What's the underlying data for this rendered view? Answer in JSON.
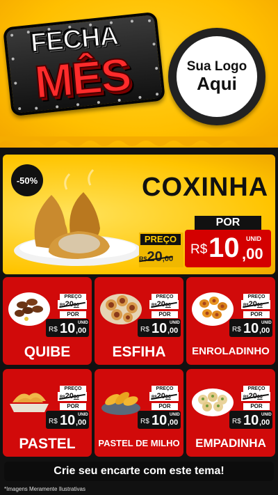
{
  "header": {
    "badge_line1": "FECHA",
    "badge_line2": "MÊS",
    "logo_line1": "Sua Logo",
    "logo_line2": "Aqui"
  },
  "featured": {
    "discount": "-50%",
    "name": "COXINHA",
    "preco_label": "PREÇO",
    "old_currency": "R$",
    "old_int": "20",
    "old_dec": ",00",
    "por_label": "POR",
    "new_currency": "R$",
    "new_int": "10",
    "new_dec": ",00",
    "unid": "UNID"
  },
  "products": [
    {
      "name": "QUIBE",
      "preco_label": "PREÇO",
      "old_currency": "R$",
      "old_int": "20",
      "old_dec": "00",
      "por_label": "POR",
      "new_currency": "R$",
      "new_int": "10",
      "new_dec": ",00",
      "unid": "UNID"
    },
    {
      "name": "ESFIHA",
      "preco_label": "PREÇO",
      "old_currency": "R$",
      "old_int": "20",
      "old_dec": "00",
      "por_label": "POR",
      "new_currency": "R$",
      "new_int": "10",
      "new_dec": ",00",
      "unid": "UNID"
    },
    {
      "name": "ENROLADINHO",
      "preco_label": "PREÇO",
      "old_currency": "R$",
      "old_int": "20",
      "old_dec": "00",
      "por_label": "POR",
      "new_currency": "R$",
      "new_int": "10",
      "new_dec": ",00",
      "unid": "UNID"
    },
    {
      "name": "PASTEL",
      "preco_label": "PREÇO",
      "old_currency": "R$",
      "old_int": "20",
      "old_dec": "00",
      "por_label": "POR",
      "new_currency": "R$",
      "new_int": "10",
      "new_dec": ",00",
      "unid": "UNID"
    },
    {
      "name": "PASTEL DE MILHO",
      "preco_label": "PREÇO",
      "old_currency": "R$",
      "old_int": "20",
      "old_dec": "00",
      "por_label": "POR",
      "new_currency": "R$",
      "new_int": "10",
      "new_dec": ",00",
      "unid": "UNID"
    },
    {
      "name": "EMPADINHA",
      "preco_label": "PREÇO",
      "old_currency": "R$",
      "old_int": "20",
      "old_dec": "00",
      "por_label": "POR",
      "new_currency": "R$",
      "new_int": "10",
      "new_dec": ",00",
      "unid": "UNID"
    }
  ],
  "cta": "Crie seu encarte com este tema!",
  "footnote": "*Imagens Meramente Ilustrativas",
  "colors": {
    "yellow": "#ffc400",
    "red": "#d10a0a",
    "black": "#111111",
    "white": "#ffffff"
  }
}
